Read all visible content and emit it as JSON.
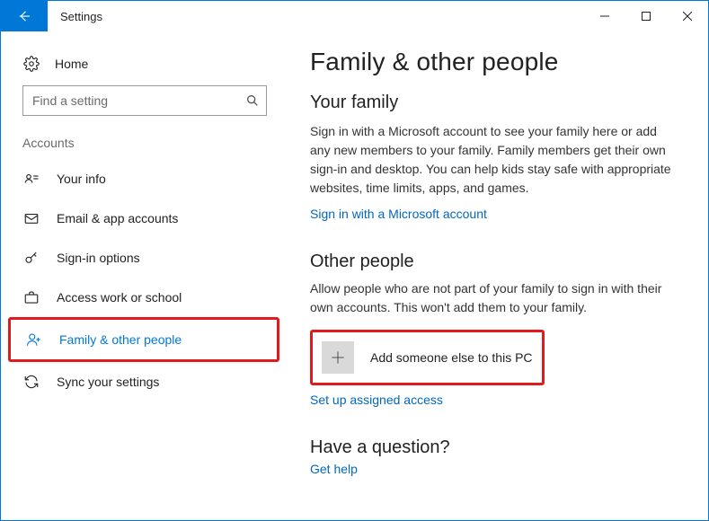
{
  "window": {
    "title": "Settings"
  },
  "sidebar": {
    "home_label": "Home",
    "search_placeholder": "Find a setting",
    "category": "Accounts",
    "items": [
      {
        "label": "Your info"
      },
      {
        "label": "Email & app accounts"
      },
      {
        "label": "Sign-in options"
      },
      {
        "label": "Access work or school"
      },
      {
        "label": "Family & other people"
      },
      {
        "label": "Sync your settings"
      }
    ]
  },
  "main": {
    "page_title": "Family & other people",
    "family": {
      "heading": "Your family",
      "body": "Sign in with a Microsoft account to see your family here or add any new members to your family. Family members get their own sign-in and desktop. You can help kids stay safe with appropriate websites, time limits, apps, and games.",
      "link": "Sign in with a Microsoft account"
    },
    "other": {
      "heading": "Other people",
      "body": "Allow people who are not part of your family to sign in with their own accounts. This won't add them to your family.",
      "add_label": "Add someone else to this PC",
      "assigned_link": "Set up assigned access"
    },
    "question": {
      "heading": "Have a question?",
      "link": "Get help"
    }
  }
}
